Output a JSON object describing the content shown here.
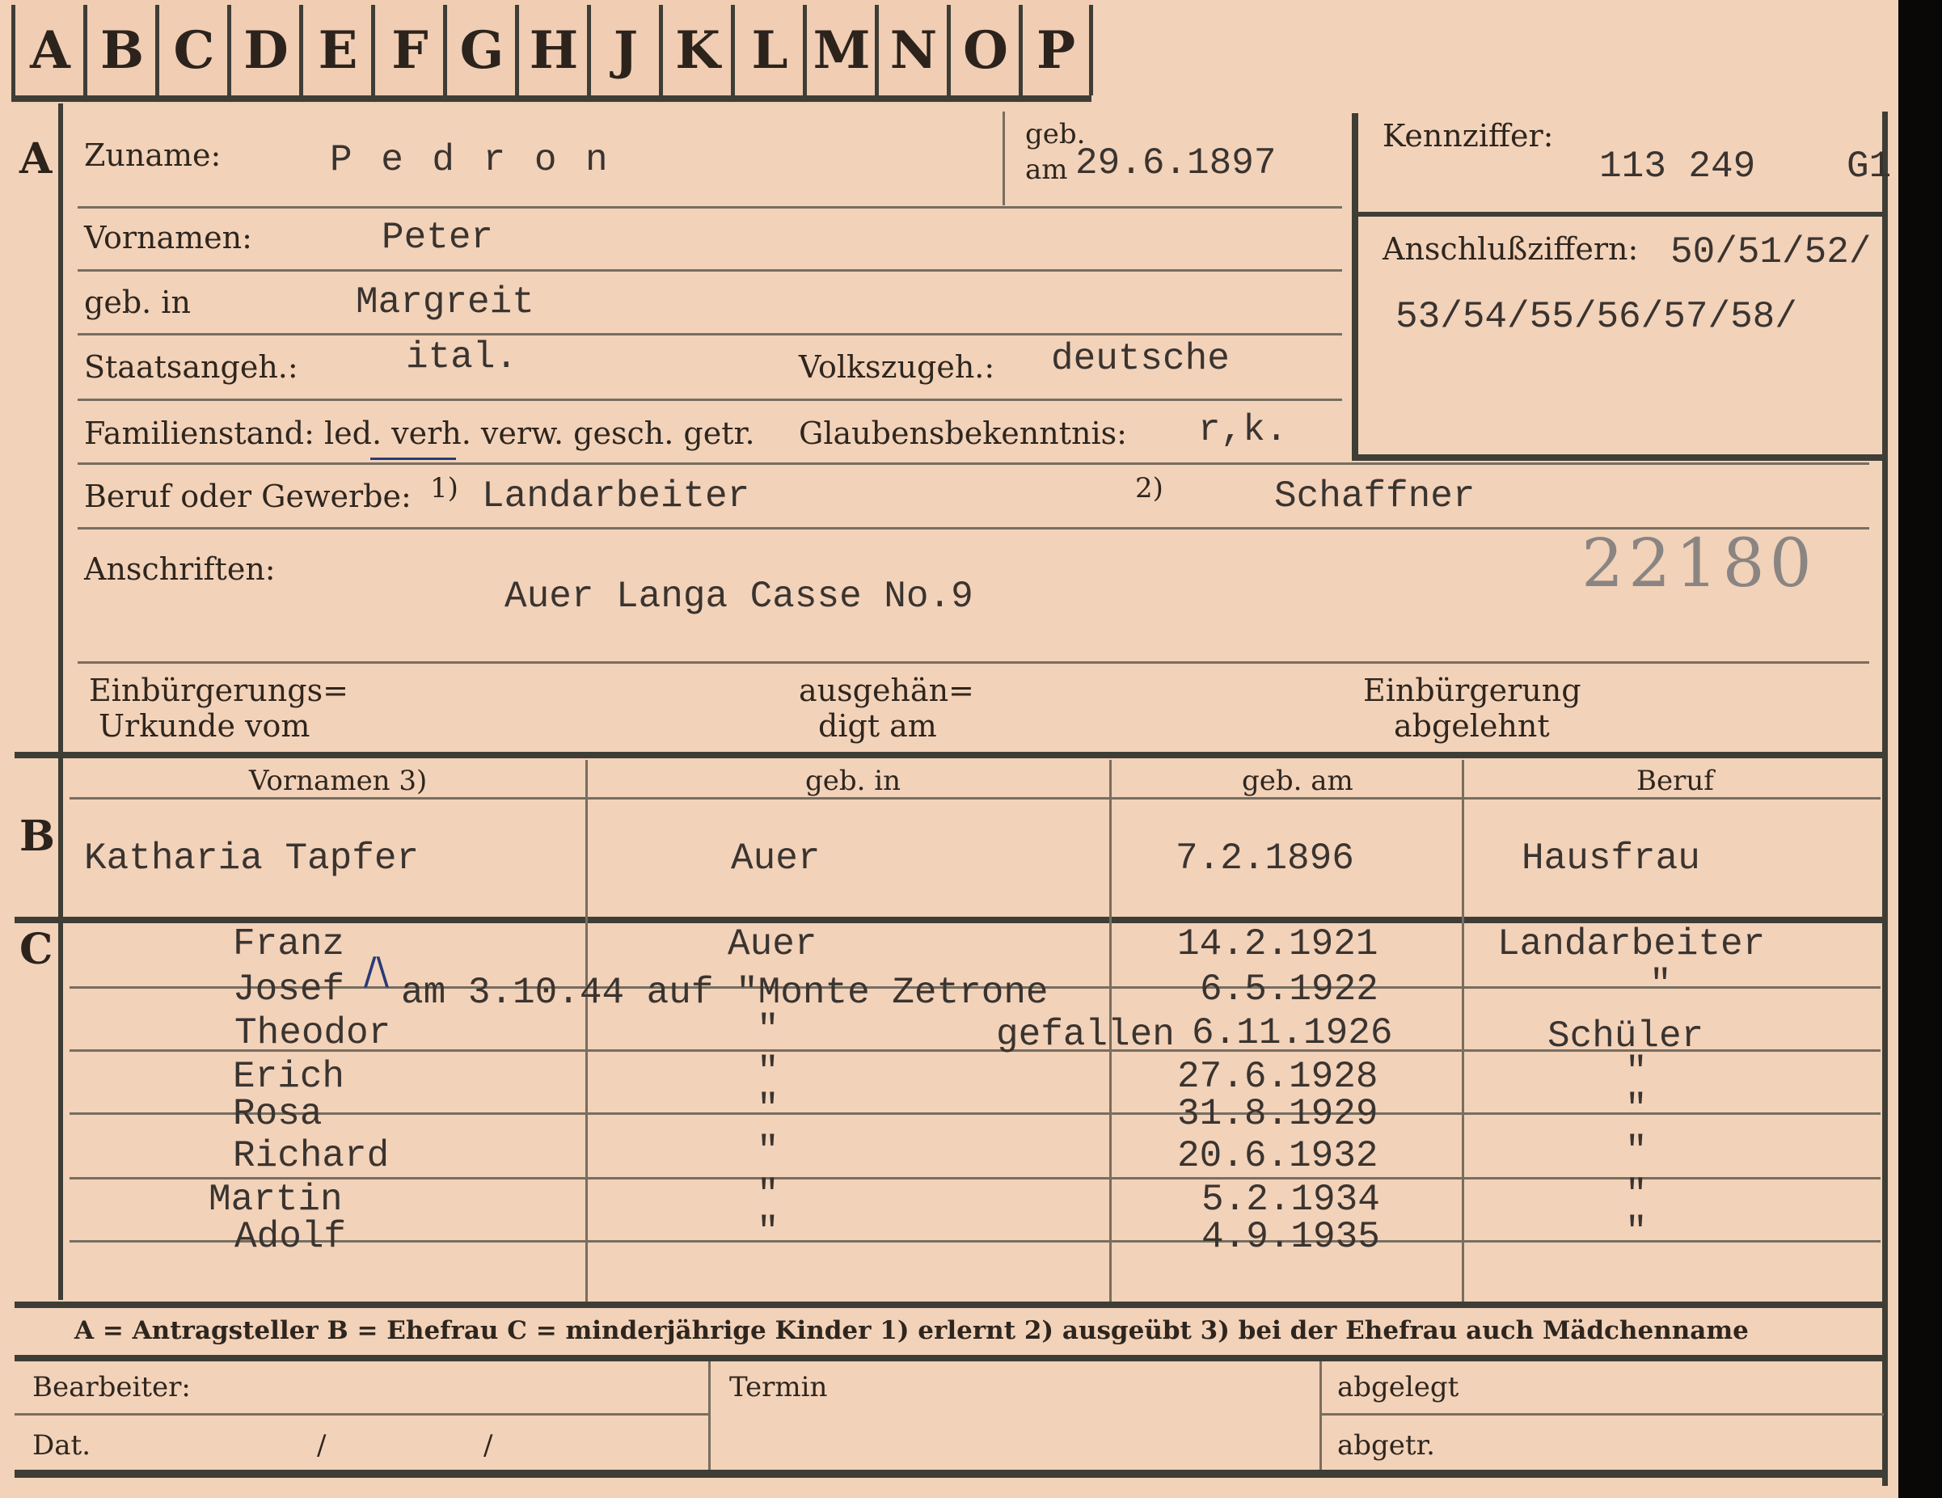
{
  "tabs": [
    "A",
    "B",
    "C",
    "D",
    "E",
    "F",
    "G",
    "H",
    "J",
    "K",
    "L",
    "M",
    "N",
    "O",
    "P"
  ],
  "section_a": {
    "marker": "A",
    "zuname_label": "Zuname:",
    "zuname": "P e d r o n",
    "geb_am_label_1": "geb.",
    "geb_am_label_2": "am",
    "geb_am": "29.6.1897",
    "vornamen_label": "Vornamen:",
    "vornamen": "Peter",
    "geb_in_label": "geb. in",
    "geb_in": "Margreit",
    "staatsangeh_label": "Staatsangeh.:",
    "staatsangeh": "ital.",
    "volkszugeh_label": "Volkszugeh.:",
    "volkszugeh": "deutsche",
    "familienstand_label": "Familienstand: led. verh. verw. gesch. getr.",
    "glaubens_label": "Glaubensbekenntnis:",
    "glaubens": "r,k.",
    "beruf_label": "Beruf oder Gewerbe:",
    "beruf_note1": "1)",
    "beruf_1": "Landarbeiter",
    "beruf_note2": "2)",
    "beruf_2": "Schaffner",
    "anschriften_label": "Anschriften:",
    "anschrift": "Auer Langa Casse No.9",
    "card_number": "22180",
    "einb_urkunde_1": "Einbürgerungs=",
    "einb_urkunde_2": "Urkunde vom",
    "ausgehaend_1": "ausgehän=",
    "ausgehaend_2": "digt am",
    "einb_abgelehnt_1": "Einbürgerung",
    "einb_abgelehnt_2": "abgelehnt"
  },
  "kennziffer": {
    "label": "Kennziffer:",
    "value": "113 249",
    "suffix": "G1",
    "anschluss_label": "Anschlußziffern:",
    "anschluss_1": "50/51/52/",
    "anschluss_2": "53/54/55/56/57/58/"
  },
  "section_b": {
    "marker": "B",
    "headers": [
      "Vornamen 3)",
      "geb. in",
      "geb. am",
      "Beruf"
    ],
    "row": [
      "Katharia Tapfer",
      "Auer",
      "7.2.1896",
      "Hausfrau"
    ]
  },
  "section_c": {
    "marker": "C",
    "note": "am 3.10.44 auf \"Monte Zetrone",
    "note2": "gefallen",
    "children": [
      {
        "name": "Franz",
        "place": "Auer",
        "date": "14.2.1921",
        "job": "Landarbeiter"
      },
      {
        "name": "Josef",
        "place": "",
        "date": "6.5.1922",
        "job": "\""
      },
      {
        "name": "Theodor",
        "place": "\"",
        "date": "6.11.1926",
        "job": "Schüler"
      },
      {
        "name": "Erich",
        "place": "\"",
        "date": "27.6.1928",
        "job": "\""
      },
      {
        "name": "Rosa",
        "place": "\"",
        "date": "31.8.1929",
        "job": "\""
      },
      {
        "name": "Richard",
        "place": "\"",
        "date": "20.6.1932",
        "job": "\""
      },
      {
        "name": "Martin",
        "place": "\"",
        "date": "5.2.1934",
        "job": "\""
      },
      {
        "name": "Adolf",
        "place": "\"",
        "date": "4.9.1935",
        "job": "\""
      }
    ]
  },
  "legend": "A = Antragsteller   B = Ehefrau   C = minderjährige Kinder   1) erlernt   2) ausgeübt   3) bei der Ehefrau auch Mädchenname",
  "footer": {
    "bearbeiter": "Bearbeiter:",
    "dat": "Dat.",
    "slash1": "/",
    "slash2": "/",
    "termin": "Termin",
    "abgelegt": "abgelegt",
    "abgetr": "abgetr."
  }
}
